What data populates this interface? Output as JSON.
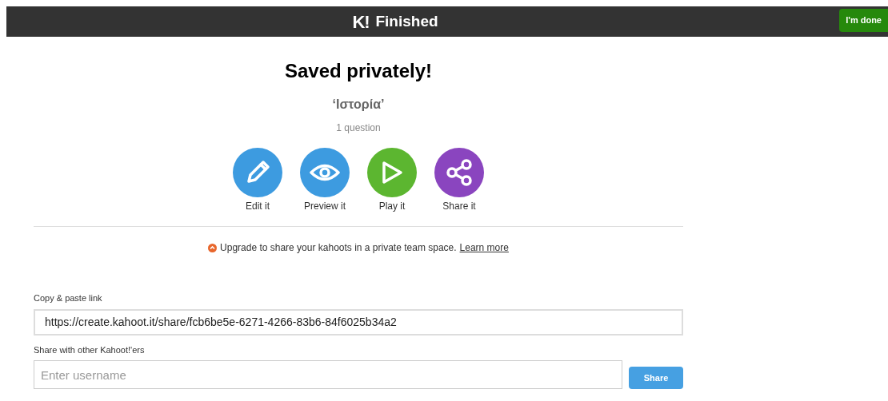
{
  "header": {
    "logo": "K!",
    "title": "Finished",
    "done_button": "I'm done"
  },
  "heading": "Saved privately!",
  "kahoot_title": "‘Ιστορία’",
  "question_count": "1 question",
  "actions": [
    {
      "kind": "edit",
      "label": "Edit it",
      "color": "#3d9be0"
    },
    {
      "kind": "preview",
      "label": "Preview it",
      "color": "#3d9be0"
    },
    {
      "kind": "play",
      "label": "Play it",
      "color": "#5cb630"
    },
    {
      "kind": "share",
      "label": "Share it",
      "color": "#8a45bf"
    }
  ],
  "upgrade": {
    "text": "Upgrade to share your kahoots in a private team space.",
    "link": "Learn more"
  },
  "link_field": {
    "label": "Copy & paste link",
    "value": "https://create.kahoot.it/share/fcb6be5e-6271-4266-83b6-84f6025b34a2"
  },
  "share_field": {
    "label": "Share with other Kahoot!'ers",
    "placeholder": "Enter username",
    "button": "Share"
  }
}
